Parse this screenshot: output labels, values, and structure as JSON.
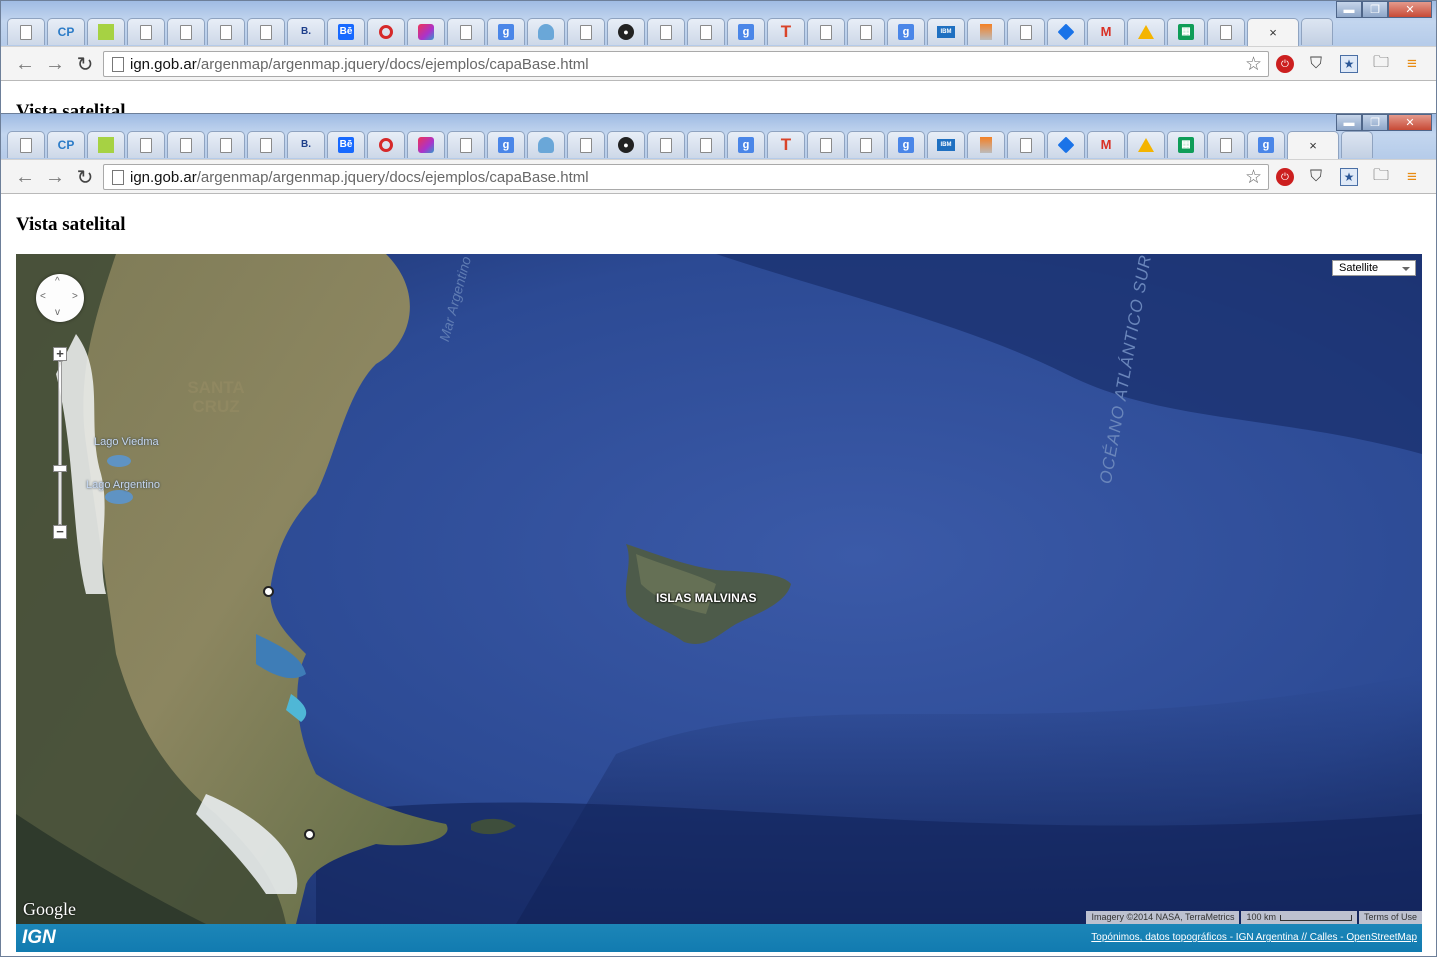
{
  "browser": {
    "tabs": [
      {
        "icon": "notepad-icon"
      },
      {
        "icon": "cp-icon",
        "text": "CP"
      },
      {
        "icon": "green-square-icon"
      },
      {
        "icon": "document-icon"
      },
      {
        "icon": "document-icon"
      },
      {
        "icon": "document-icon"
      },
      {
        "icon": "document-icon"
      },
      {
        "icon": "b-icon",
        "text": "B."
      },
      {
        "icon": "behance-icon",
        "text": "Bē"
      },
      {
        "icon": "sync-ring-icon"
      },
      {
        "icon": "cube-icon"
      },
      {
        "icon": "document-icon"
      },
      {
        "icon": "google-icon",
        "text": "g"
      },
      {
        "icon": "cloud-icon"
      },
      {
        "icon": "document-icon"
      },
      {
        "icon": "github-icon",
        "text": "●"
      },
      {
        "icon": "document-icon"
      },
      {
        "icon": "document-icon"
      },
      {
        "icon": "google-icon",
        "text": "g"
      },
      {
        "icon": "t-icon",
        "text": "T"
      },
      {
        "icon": "document-icon"
      },
      {
        "icon": "document-icon"
      },
      {
        "icon": "google-icon",
        "text": "g"
      },
      {
        "icon": "ibm-icon",
        "text": "IBM"
      },
      {
        "icon": "stack-icon"
      },
      {
        "icon": "document-icon"
      },
      {
        "icon": "diamond-icon"
      },
      {
        "icon": "gmail-icon",
        "text": "M"
      },
      {
        "icon": "drive-icon"
      },
      {
        "icon": "sheets-icon",
        "text": "▦"
      },
      {
        "icon": "document-icon"
      }
    ],
    "front_extra_tab": {
      "icon": "google-icon",
      "text": "g"
    },
    "active_tab_close": "×",
    "window_controls": {
      "minimize": "▬",
      "maximize": "❐",
      "close": "✕"
    },
    "nav": {
      "back": "←",
      "forward": "→",
      "reload": "↻"
    },
    "url": {
      "domain": "ign.gob.ar",
      "path": "/argenmap/argenmap.jquery/docs/ejemplos/capaBase.html"
    },
    "bookmark_star": "☆",
    "extensions": {
      "stop": "⏻",
      "pocket": "⛉",
      "bookmark": "★",
      "folder": "🗀",
      "menu": "≡"
    }
  },
  "page": {
    "title": "Vista satelital"
  },
  "map": {
    "map_type": "Satellite",
    "labels": {
      "mar_argentino": "Mar Argentino",
      "oceano": "OCÉANO ATLÁNTICO SUR",
      "islas": "ISLAS MALVINAS",
      "lago_viedma": "Lago Viedma",
      "lago_argentino": "Lago Argentino",
      "santa_cruz": "SANTA CRUZ"
    },
    "pan_arrows": {
      "up": "^",
      "down": "v",
      "left": "<",
      "right": ">"
    },
    "zoom": {
      "in": "+",
      "out": "−"
    },
    "google_logo": "Google",
    "imagery": "Imagery ©2014 NASA, TerraMetrics",
    "scale": "100 km",
    "terms": "Terms of Use"
  },
  "footer": {
    "logo": "IGN",
    "link": "Topónimos, datos topográficos - IGN Argentina // Calles - OpenStreetMap"
  }
}
